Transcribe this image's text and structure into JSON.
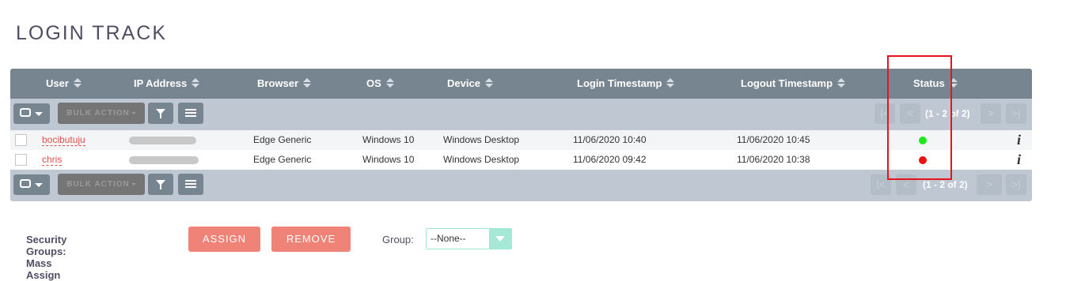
{
  "page": {
    "title": "LOGIN TRACK"
  },
  "table": {
    "columns": [
      {
        "label": "User"
      },
      {
        "label": "IP Address"
      },
      {
        "label": "Browser"
      },
      {
        "label": "OS"
      },
      {
        "label": "Device"
      },
      {
        "label": "Login Timestamp"
      },
      {
        "label": "Logout Timestamp"
      },
      {
        "label": "Status"
      }
    ],
    "toolbar": {
      "bulk_action_label": "BULK ACTION",
      "pagination_text": "(1 - 2 of 2)",
      "first_icon": "first-page-icon",
      "prev_icon": "prev-page-icon",
      "next_icon": "next-page-icon",
      "last_icon": "last-page-icon"
    },
    "rows": [
      {
        "user": "bocibutuju",
        "ip_address": "",
        "browser": "Edge Generic",
        "os": "Windows 10",
        "device": "Windows Desktop",
        "login_timestamp": "11/06/2020 10:40",
        "logout_timestamp": "11/06/2020 10:45",
        "status_color": "#1ee81e",
        "info_label": "i"
      },
      {
        "user": "chris",
        "ip_address": "",
        "browser": "Edge Generic",
        "os": "Windows 10",
        "device": "Windows Desktop",
        "login_timestamp": "11/06/2020 09:42",
        "logout_timestamp": "11/06/2020 10:38",
        "status_color": "#ee1111",
        "info_label": "i"
      }
    ]
  },
  "mass_assign": {
    "label": "Security Groups: Mass Assign",
    "assign_label": "ASSIGN",
    "remove_label": "REMOVE",
    "group_label": "Group:",
    "group_value": "--None--"
  },
  "colors": {
    "header_bg": "#778591",
    "toolbar_bg": "#bfc8d2",
    "accent": "#f08377",
    "link": "#e2504c",
    "highlight": "#e8141c"
  }
}
